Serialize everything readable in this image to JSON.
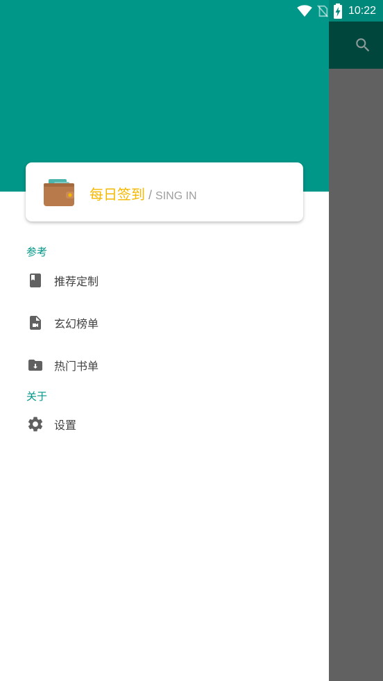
{
  "status_bar": {
    "time": "10:22",
    "icons": [
      "wifi-icon",
      "no-sim-icon",
      "battery-charging-icon"
    ]
  },
  "colors": {
    "primary": "#009688",
    "primary_dark": "#00463d",
    "accent_gold": "#f5b800",
    "scrim": "#616161"
  },
  "signin_card": {
    "icon": "wallet-icon",
    "title": "每日签到",
    "separator": "/",
    "subtitle": "SING IN"
  },
  "menu": {
    "section_reference": "参考",
    "items_reference": [
      {
        "icon": "book-icon",
        "label": "推荐定制"
      },
      {
        "icon": "video-file-icon",
        "label": "玄幻榜单"
      },
      {
        "icon": "folder-download-icon",
        "label": "热门书单"
      }
    ],
    "section_about": "关于",
    "items_about": [
      {
        "icon": "gear-icon",
        "label": "设置"
      }
    ]
  },
  "toolbar": {
    "search_icon": "search-icon"
  }
}
